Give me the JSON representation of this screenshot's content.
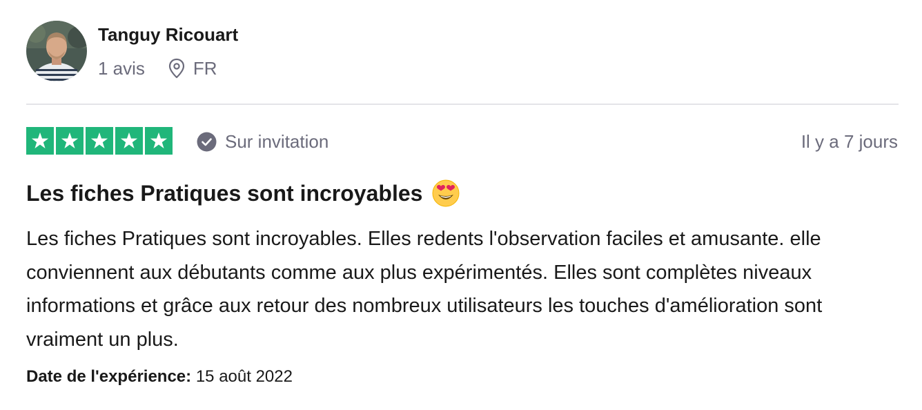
{
  "reviewer": {
    "name": "Tanguy Ricouart",
    "review_count": "1 avis",
    "country": "FR",
    "location_icon": "map-pin-icon"
  },
  "rating": {
    "stars": 5,
    "max_stars": 5,
    "star_color": "#20b67a",
    "star_icon": "star-icon"
  },
  "badge": {
    "label": "Sur invitation",
    "icon": "check-circle-icon"
  },
  "review": {
    "posted": "Il y a 7 jours",
    "title": "Les fiches Pratiques sont incroyables",
    "title_emoji": "heart-eyes-emoji",
    "body": "Les fiches Pratiques sont incroyables. Elles redents l'observation faciles et amusante. elle conviennent aux débutants comme aux plus expérimentés. Elles sont complètes niveaux informations et grâce aux retour des nombreux utilisateurs les touches d'amélioration sont vraiment un plus.",
    "experience_label": "Date de l'expérience:",
    "experience_date": "15 août 2022"
  },
  "colors": {
    "text_primary": "#191919",
    "text_secondary": "#6b6b7b",
    "divider": "#e4e4e8"
  }
}
